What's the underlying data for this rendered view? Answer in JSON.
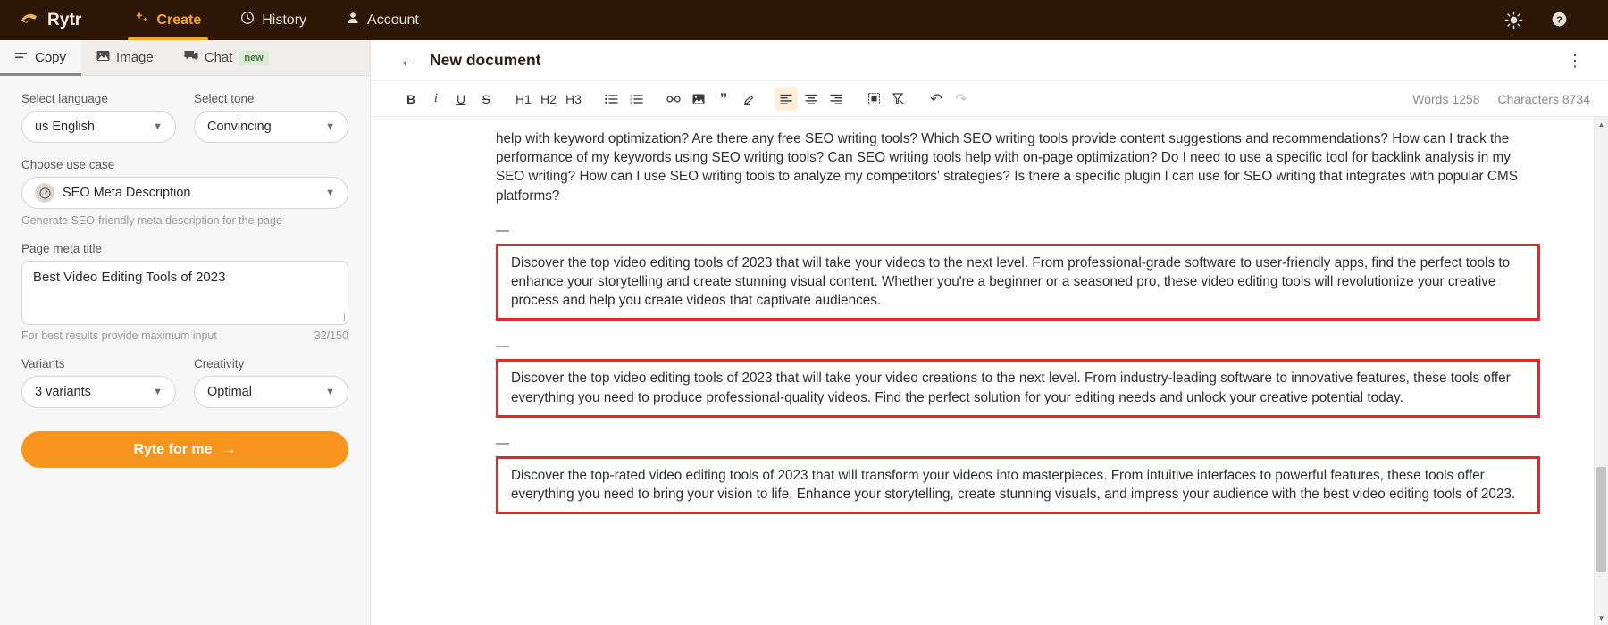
{
  "topbar": {
    "brand": "Rytr",
    "brand_icon": "hand-writing-icon",
    "nav": [
      {
        "label": "Create",
        "icon": "sparkles-icon",
        "active": true
      },
      {
        "label": "History",
        "icon": "clock-icon",
        "active": false
      },
      {
        "label": "Account",
        "icon": "person-icon",
        "active": false
      }
    ],
    "right_icons": [
      {
        "name": "sun-icon",
        "label": "Toggle theme"
      },
      {
        "name": "help-icon",
        "label": "Help"
      }
    ],
    "bg_color": "#2e1607",
    "accent_color": "#f5a623"
  },
  "sidebar": {
    "tabs": [
      {
        "label": "Copy",
        "icon": "lines-icon",
        "active": true,
        "badge": ""
      },
      {
        "label": "Image",
        "icon": "image-icon",
        "active": false,
        "badge": ""
      },
      {
        "label": "Chat",
        "icon": "chat-icon",
        "active": false,
        "badge": "new"
      }
    ],
    "language": {
      "label": "Select language",
      "value": "us English"
    },
    "tone": {
      "label": "Select tone",
      "value": "Convincing"
    },
    "use_case": {
      "label": "Choose use case",
      "value": "SEO Meta Description",
      "icon": "gauge-icon",
      "hint": "Generate SEO-friendly meta description for the page"
    },
    "meta_title": {
      "label": "Page meta title",
      "value": "Best Video Editing Tools of 2023",
      "placeholder": "Best Video Editing Tools of 2023",
      "hint": "For best results provide maximum input",
      "counter": "32/150"
    },
    "variants": {
      "label": "Variants",
      "value": "3 variants"
    },
    "creativity": {
      "label": "Creativity",
      "value": "Optimal"
    },
    "cta": {
      "label": "Ryte for me",
      "arrow": "→",
      "color": "#f7951e"
    }
  },
  "document": {
    "back_icon": "arrow-left-icon",
    "title": "New document",
    "menu_icon": "kebab-menu-icon",
    "toolbar": [
      {
        "name": "bold",
        "glyph": "B",
        "style": "bold",
        "active": false
      },
      {
        "name": "italic",
        "glyph": "i",
        "style": "italic",
        "active": false
      },
      {
        "name": "underline",
        "glyph": "U",
        "style": "underline",
        "active": false
      },
      {
        "name": "strikethrough",
        "glyph": "S",
        "style": "strike",
        "active": false
      },
      {
        "name": "heading-1",
        "glyph": "H1",
        "style": "plain",
        "active": false
      },
      {
        "name": "heading-2",
        "glyph": "H2",
        "style": "plain",
        "active": false
      },
      {
        "name": "heading-3",
        "glyph": "H3",
        "style": "plain",
        "active": false
      },
      {
        "name": "bullet-list",
        "glyph": "☰",
        "style": "plain",
        "active": false
      },
      {
        "name": "numbered-list",
        "glyph": "≣",
        "style": "plain",
        "active": false
      },
      {
        "name": "link",
        "glyph": "∞",
        "style": "plain",
        "active": false
      },
      {
        "name": "image",
        "glyph": "◰",
        "style": "plain",
        "active": false
      },
      {
        "name": "quote",
        "glyph": "”",
        "style": "plain",
        "active": false
      },
      {
        "name": "highlighter",
        "glyph": "✐",
        "style": "plain",
        "active": false
      },
      {
        "name": "align-left",
        "glyph": "≡",
        "style": "plain",
        "active": true
      },
      {
        "name": "align-center",
        "glyph": "≡",
        "style": "plain",
        "active": false
      },
      {
        "name": "align-right",
        "glyph": "≡",
        "style": "plain",
        "active": false
      },
      {
        "name": "table",
        "glyph": "▦",
        "style": "plain",
        "active": false
      },
      {
        "name": "clear-format",
        "glyph": "⨯",
        "style": "plain",
        "active": false
      },
      {
        "name": "undo",
        "glyph": "↶",
        "style": "plain",
        "active": false
      },
      {
        "name": "redo",
        "glyph": "↷",
        "style": "disabled",
        "active": false
      }
    ],
    "word_count": "Words 1258",
    "char_count": "Characters 8734",
    "body_text": "help with keyword optimization? Are there any free SEO writing tools? Which SEO writing tools provide content suggestions and recommendations? How can I track the performance of my keywords using SEO writing tools? Can SEO writing tools help with on-page optimization? Do I need to use a specific tool for backlink analysis in my SEO writing? How can I use SEO writing tools to analyze my competitors' strategies? Is there a specific plugin I can use for SEO writing that integrates with popular CMS platforms?",
    "separator": "—",
    "variants": [
      "Discover the top video editing tools of 2023 that will take your videos to the next level. From professional-grade software to user-friendly apps, find the perfect tools to enhance your storytelling and create stunning visual content. Whether you're a beginner or a seasoned pro, these video editing tools will revolutionize your creative process and help you create videos that captivate audiences.",
      "Discover the top video editing tools of 2023 that will take your video creations to the next level. From industry-leading software to innovative features, these tools offer everything you need to produce professional-quality videos. Find the perfect solution for your editing needs and unlock your creative potential today.",
      "Discover the top-rated video editing tools of 2023 that will transform your videos into masterpieces. From intuitive interfaces to powerful features, these tools offer everything you need to bring your vision to life. Enhance your storytelling, create stunning visuals, and impress your audience with the best video editing tools of 2023."
    ],
    "highlight_color": "#e8252a"
  }
}
